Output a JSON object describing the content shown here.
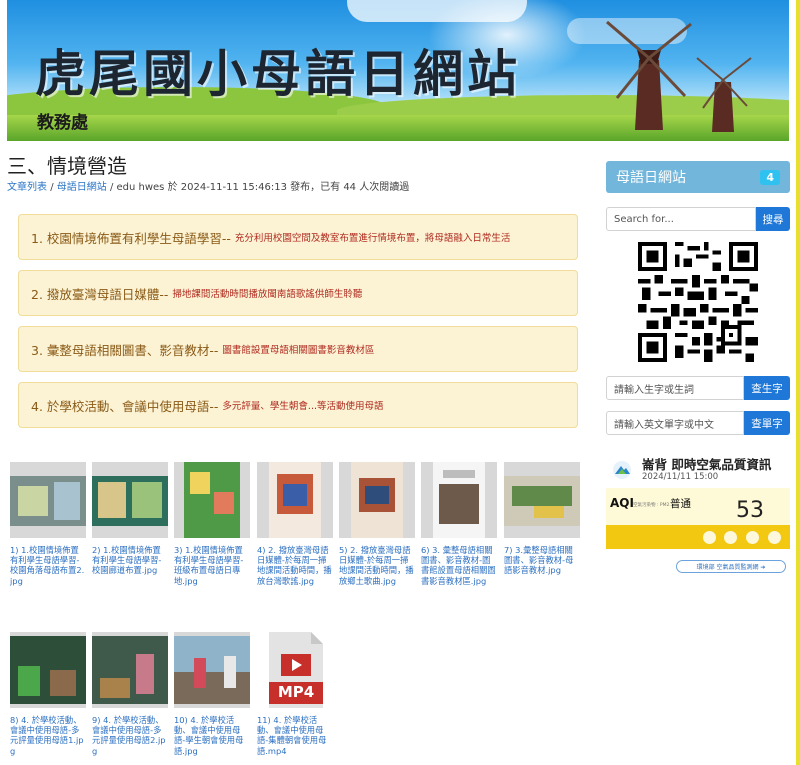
{
  "banner": {
    "title": "虎尾國小母語日網站",
    "office": "教務處"
  },
  "article": {
    "title": "三、情境營造",
    "breadcrumb": {
      "list_link": "文章列表",
      "separator": "/",
      "category_link": "母語日網站",
      "author_info": "edu hwes 於 2024-11-11 15:46:13 發布，已有 44 人次閱讀過"
    },
    "cards": [
      {
        "head": "1. 校園情境佈置有利學生母語學習--",
        "desc": "充分利用校園空間及教室布置進行情境布置，將母語融入日常生活"
      },
      {
        "head": "2. 撥放臺灣母語日媒體--",
        "desc": "掃地課間活動時間播放閩南語歌謠供師生聆聽"
      },
      {
        "head": "3. 彙整母語相關圖書、影音教材--",
        "desc": "圖書館設置母語相關圖書影音教材區"
      },
      {
        "head": "4. 於學校活動、會議中使用母語--",
        "desc": "多元評量、學生朝會...等活動使用母語"
      }
    ],
    "files": [
      {
        "caption": "1) 1.校園情境佈置有利學生母語學習-校園角落母語布置2.jpg"
      },
      {
        "caption": "2) 1.校園情境佈置有利學生母語學習-校園廊道布置.jpg"
      },
      {
        "caption": "3) 1.校園情境佈置有利學生母語學習-班級布置母語日專地.jpg"
      },
      {
        "caption": "4) 2. 撥放臺灣母語日媒體-於每周一掃地課間活動時間，播放台灣歌謠.jpg"
      },
      {
        "caption": "5) 2. 撥放臺灣母語日媒體-於每周一掃地課間活動時間，播放鄉土歌曲.jpg"
      },
      {
        "caption": "6) 3. 彙整母語相關圖書、影音教材-圖書館設置母語相關圖書影音教材區.jpg"
      },
      {
        "caption": "7) 3.彙整母語相關圖書、影音教材-母語影音教材.jpg"
      },
      {
        "caption": "8) 4. 於學校活動、會議中使用母語-多元評量使用母語1.jpg"
      },
      {
        "caption": "9) 4. 於學校活動、會議中使用母語-多元評量使用母語2.jpg"
      },
      {
        "caption": "10) 4. 於學校活動、會議中使用母語-學生朝會使用母語.jpg"
      },
      {
        "caption": "11) 4. 於學校活動、會議中使用母語-集體朝會使用母語.mp4",
        "badge": "MP4"
      }
    ]
  },
  "sidebar": {
    "header": {
      "title": "母語日網站",
      "count": "4"
    },
    "search": {
      "placeholder": "Search for...",
      "button": "搜尋"
    },
    "char_lookup": {
      "placeholder": "請輸入生字或生詞",
      "button": "查生字"
    },
    "word_lookup": {
      "placeholder": "請輸入英文單字或中文",
      "button": "查單字"
    },
    "aqi": {
      "station": "崙背 即時空氣品質資訊",
      "time": "2024/11/11 15:00",
      "label": "AQI",
      "sublabel": "空氣污染物 : PM2.5",
      "status": "普通",
      "value": "53",
      "link": "環境部 空氣品質監測網 ➔"
    }
  },
  "colors": {
    "accent": "#1f78d7",
    "card_bg": "#fcf3d4",
    "card_border": "#f1dc9a",
    "card_desc": "#b02a1f",
    "sidebar_head": "#72b6db",
    "aqi_yellow": "#f2c811"
  }
}
